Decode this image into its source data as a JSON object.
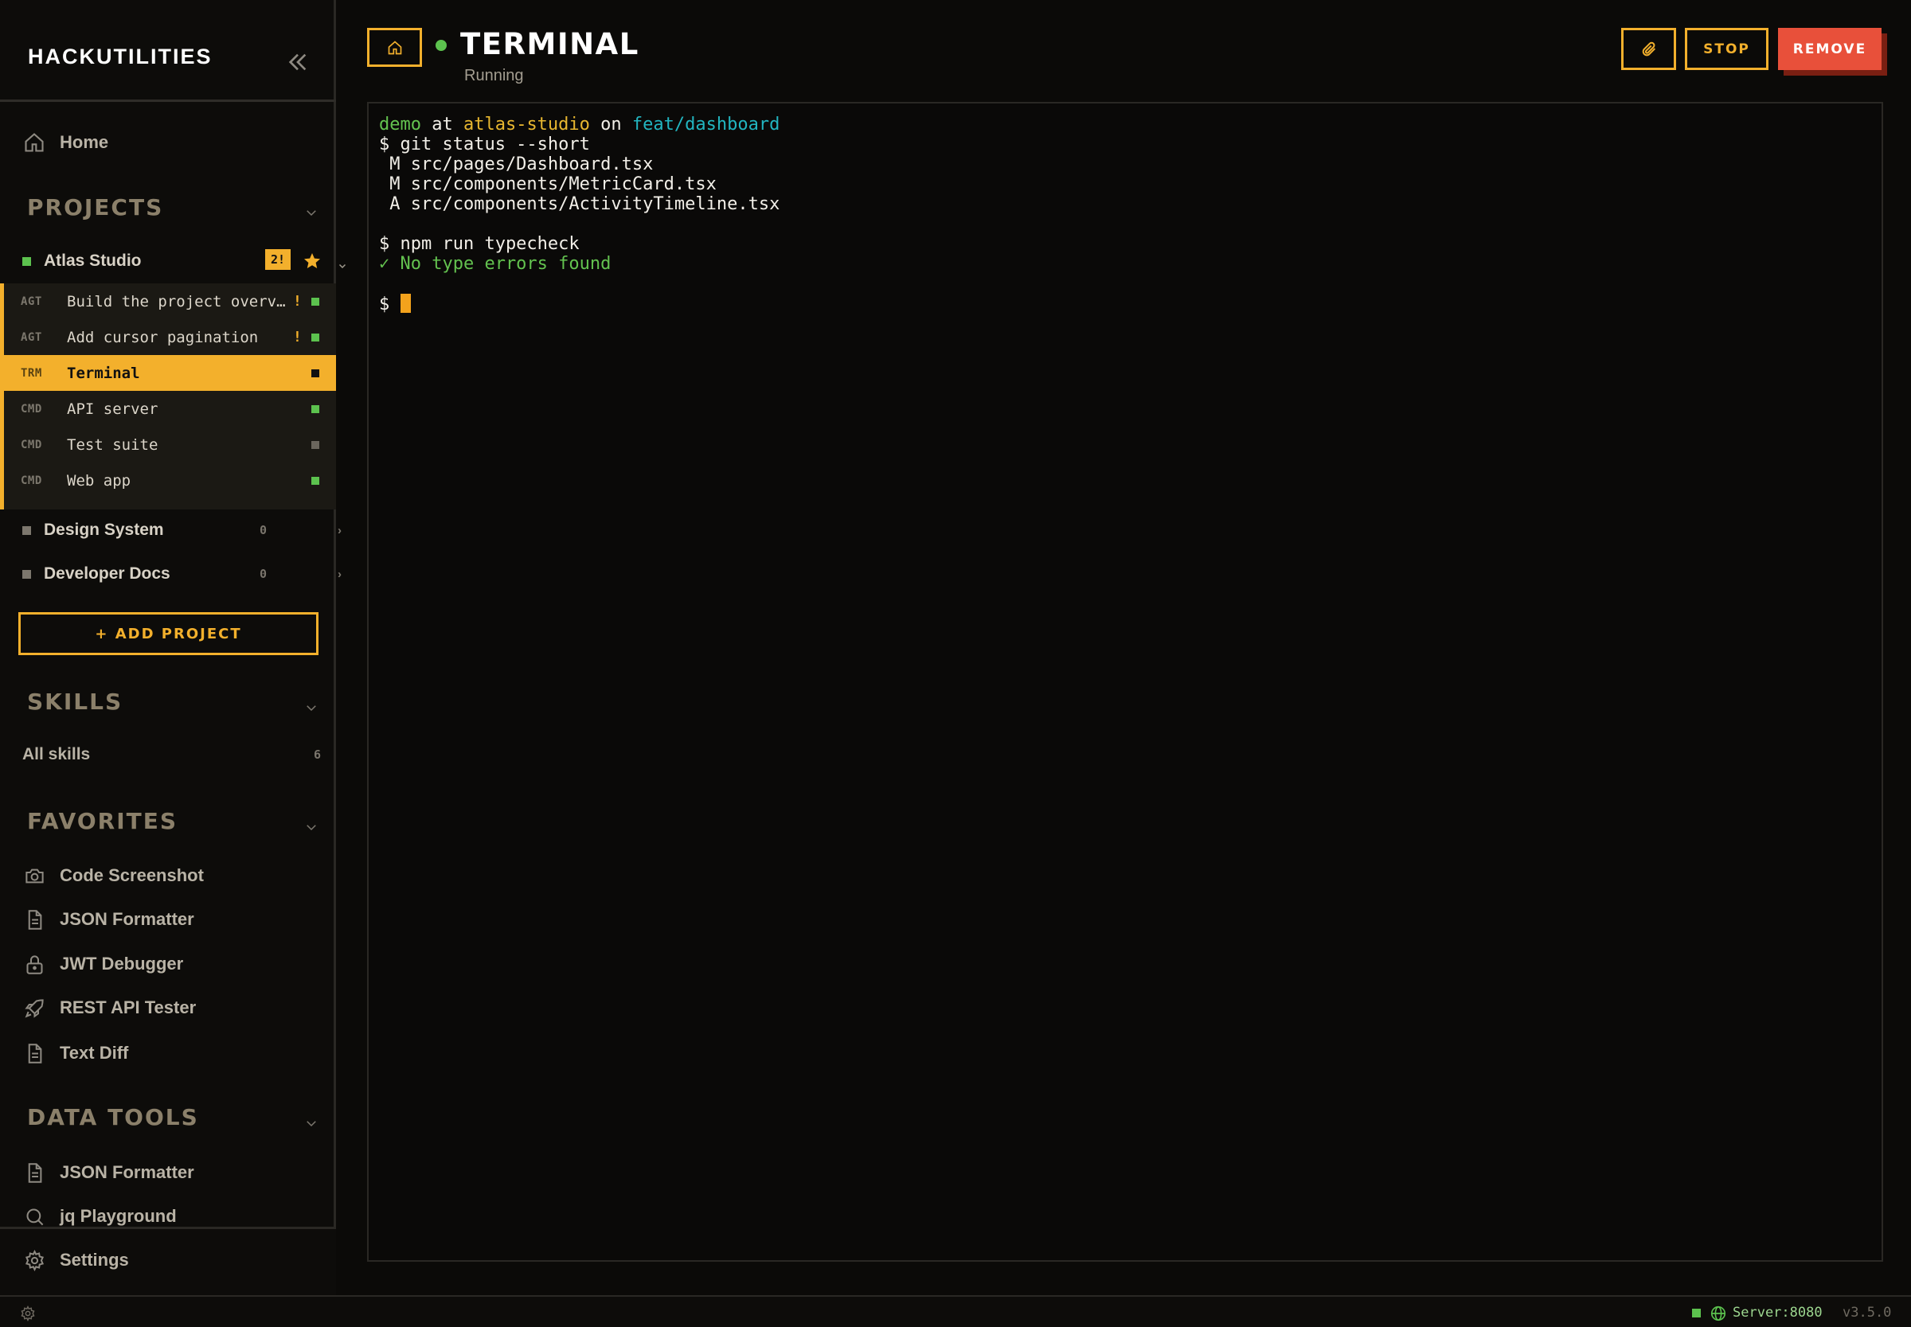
{
  "sidebar": {
    "brand": "HACKUTILITIES",
    "home_label": "Home",
    "projects_heading": "PROJECTS",
    "projects": [
      {
        "name": "Atlas Studio",
        "badge": "2!",
        "color": "#5cc24e"
      },
      {
        "name": "Design System",
        "count": "0",
        "color": "#7c776d"
      },
      {
        "name": "Developer Docs",
        "count": "0",
        "color": "#7c776d"
      }
    ],
    "sessions": [
      {
        "type": "AGT",
        "label": "Build the project overview dashboard",
        "alert": "!",
        "status_color": "#5cc24e"
      },
      {
        "type": "AGT",
        "label": "Add cursor pagination",
        "alert": "!",
        "status_color": "#5cc24e"
      },
      {
        "type": "TRM",
        "label": "Terminal",
        "status_color": "#111111"
      },
      {
        "type": "CMD",
        "label": "API server",
        "status_color": "#5cc24e"
      },
      {
        "type": "CMD",
        "label": "Test suite",
        "status_color": "#6b665d"
      },
      {
        "type": "CMD",
        "label": "Web app",
        "status_color": "#5cc24e"
      }
    ],
    "add_project_label": "+ ADD PROJECT",
    "skills_heading": "SKILLS",
    "all_skills_label": "All skills",
    "all_skills_count": "6",
    "favorites_heading": "FAVORITES",
    "favorites": [
      {
        "label": "Code Screenshot",
        "icon": "camera-icon"
      },
      {
        "label": "JSON Formatter",
        "icon": "file-icon"
      },
      {
        "label": "JWT Debugger",
        "icon": "lock-icon"
      },
      {
        "label": "REST API Tester",
        "icon": "rocket-icon"
      },
      {
        "label": "Text Diff",
        "icon": "file-icon"
      }
    ],
    "data_tools_heading": "DATA TOOLS",
    "data_tools": [
      {
        "label": "JSON Formatter",
        "icon": "file-icon"
      },
      {
        "label": "jq Playground",
        "icon": "search-icon"
      }
    ],
    "settings_label": "Settings"
  },
  "header": {
    "title": "TERMINAL",
    "status": "Running",
    "stop_label": "STOP",
    "remove_label": "REMOVE"
  },
  "terminal": {
    "prompt_user": "demo",
    "prompt_at": " at ",
    "prompt_host": "atlas-studio",
    "prompt_on": " on ",
    "prompt_branch": "feat/dashboard",
    "cmd1": "$ git status --short",
    "out1": " M src/pages/Dashboard.tsx",
    "out2": " M src/components/MetricCard.tsx",
    "out3": " A src/components/ActivityTimeline.tsx",
    "cmd2": "$ npm run typecheck",
    "out4": "✓ No type errors found",
    "prompt_end": "$ "
  },
  "statusbar": {
    "server": "Server:8080",
    "version": "v3.5.0"
  },
  "colors": {
    "accent": "#f3b02c",
    "danger": "#e8503a",
    "running": "#5cc24e"
  }
}
